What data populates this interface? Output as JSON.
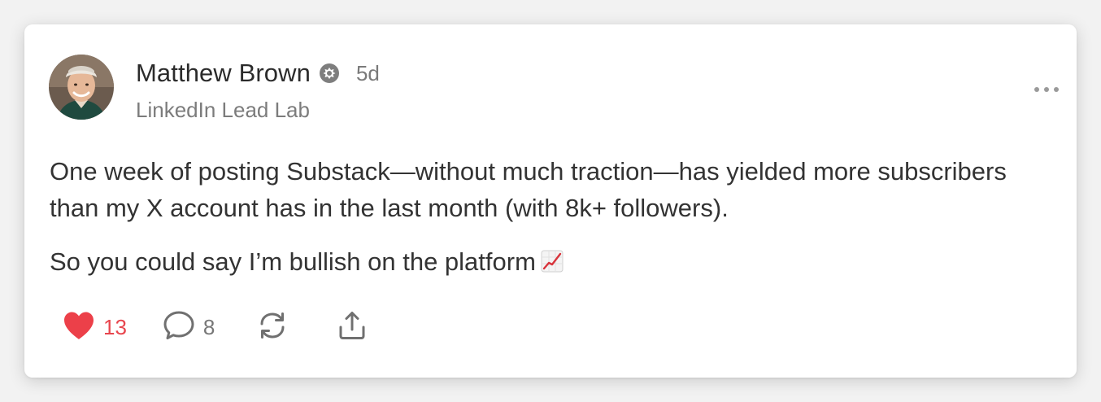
{
  "post": {
    "author": {
      "name": "Matthew Brown",
      "badge_icon": "substack-badge-icon",
      "time_ago": "5d",
      "publication": "LinkedIn Lead Lab"
    },
    "menu_icon": "more-dots-icon",
    "body": {
      "paragraph_1": "One week of posting Substack—without much traction—has yielded more subscribers than my X account has in the last month (with 8k+ followers).",
      "paragraph_2": "So you could say I’m bullish on the platform",
      "emoji": "chart-increasing-emoji"
    },
    "actions": {
      "likes": "13",
      "comments": "8",
      "restack_icon": "restack-icon",
      "share_icon": "share-icon"
    }
  },
  "colors": {
    "like_red": "#e8454d",
    "text": "#333333",
    "muted": "#7c7c7c"
  }
}
